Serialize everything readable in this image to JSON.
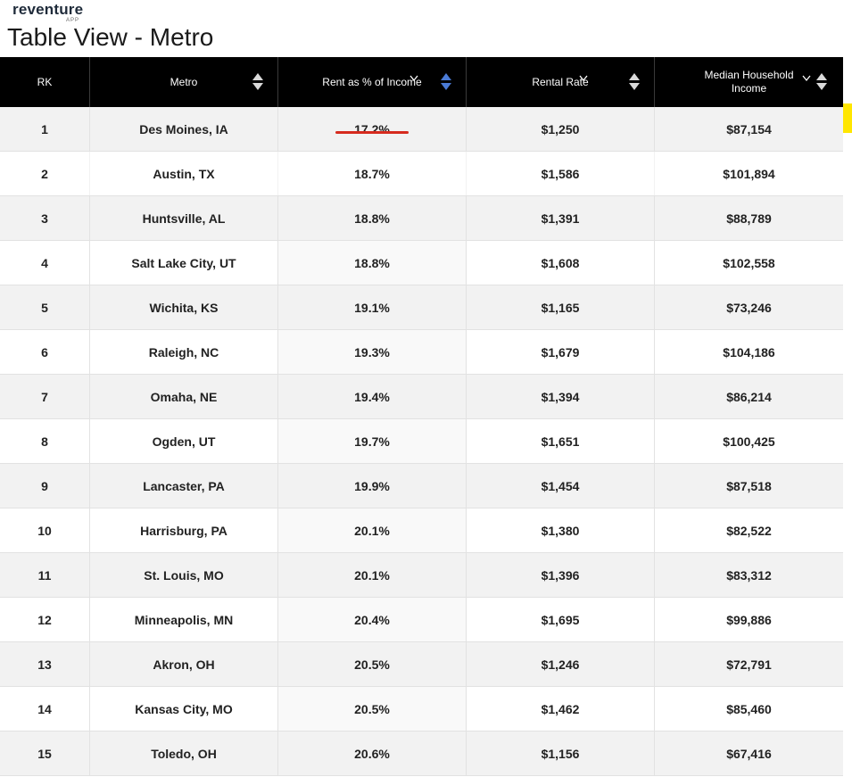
{
  "brand": {
    "name": "reventure",
    "sub": "APP"
  },
  "page_title": "Table View - Metro",
  "columns": {
    "rank": "RK",
    "metro": "Metro",
    "rent_pct": "Rent as % of Income",
    "rental_rate": "Rental Rate",
    "income": "Median Household Income"
  },
  "colors": {
    "highlight": "#ffe600",
    "underline": "#d62b1e",
    "header_bg": "#000000",
    "sort_active": "#4a7bd6"
  },
  "highlighted_row": 2,
  "rows": [
    {
      "rank": "1",
      "metro": "Des Moines, IA",
      "rent_pct": "17.2%",
      "rental_rate": "$1,250",
      "income": "$87,154"
    },
    {
      "rank": "2",
      "metro": "Austin, TX",
      "rent_pct": "18.7%",
      "rental_rate": "$1,586",
      "income": "$101,894"
    },
    {
      "rank": "3",
      "metro": "Huntsville, AL",
      "rent_pct": "18.8%",
      "rental_rate": "$1,391",
      "income": "$88,789"
    },
    {
      "rank": "4",
      "metro": "Salt Lake City, UT",
      "rent_pct": "18.8%",
      "rental_rate": "$1,608",
      "income": "$102,558"
    },
    {
      "rank": "5",
      "metro": "Wichita, KS",
      "rent_pct": "19.1%",
      "rental_rate": "$1,165",
      "income": "$73,246"
    },
    {
      "rank": "6",
      "metro": "Raleigh, NC",
      "rent_pct": "19.3%",
      "rental_rate": "$1,679",
      "income": "$104,186"
    },
    {
      "rank": "7",
      "metro": "Omaha, NE",
      "rent_pct": "19.4%",
      "rental_rate": "$1,394",
      "income": "$86,214"
    },
    {
      "rank": "8",
      "metro": "Ogden, UT",
      "rent_pct": "19.7%",
      "rental_rate": "$1,651",
      "income": "$100,425"
    },
    {
      "rank": "9",
      "metro": "Lancaster, PA",
      "rent_pct": "19.9%",
      "rental_rate": "$1,454",
      "income": "$87,518"
    },
    {
      "rank": "10",
      "metro": "Harrisburg, PA",
      "rent_pct": "20.1%",
      "rental_rate": "$1,380",
      "income": "$82,522"
    },
    {
      "rank": "11",
      "metro": "St. Louis, MO",
      "rent_pct": "20.1%",
      "rental_rate": "$1,396",
      "income": "$83,312"
    },
    {
      "rank": "12",
      "metro": "Minneapolis, MN",
      "rent_pct": "20.4%",
      "rental_rate": "$1,695",
      "income": "$99,886"
    },
    {
      "rank": "13",
      "metro": "Akron, OH",
      "rent_pct": "20.5%",
      "rental_rate": "$1,246",
      "income": "$72,791"
    },
    {
      "rank": "14",
      "metro": "Kansas City, MO",
      "rent_pct": "20.5%",
      "rental_rate": "$1,462",
      "income": "$85,460"
    },
    {
      "rank": "15",
      "metro": "Toledo, OH",
      "rent_pct": "20.6%",
      "rental_rate": "$1,156",
      "income": "$67,416"
    }
  ]
}
